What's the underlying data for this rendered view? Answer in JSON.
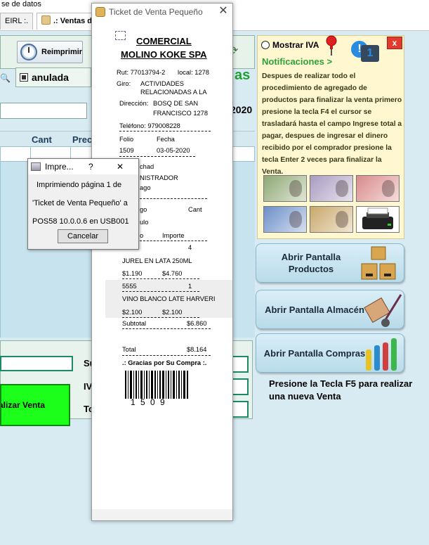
{
  "window": {
    "title_fragment": "se de datos"
  },
  "tabs": [
    {
      "label": "EIRL :."
    },
    {
      "label": ".: Ventas d"
    }
  ],
  "main": {
    "reimprimir_label": "Reimprimir",
    "anulada_label": "anulada",
    "right_fragment": "as",
    "year_fragment": "2020",
    "grid_headers": [
      "Cant",
      "Prec"
    ],
    "realizar_venta_label": "alizar Venta",
    "summary_labels": [
      "Su",
      "IV",
      "To"
    ]
  },
  "notification": {
    "mostrar_iva_label": "Mostrar IVA",
    "badge_count": "1",
    "close_symbol": "x",
    "title": "Notificaciones >",
    "body": "Despues de realizar todo el procedimiento de agregado de productos para finalizar la venta primero presione la tecla F4 el cursor se trasladará hasta el campo Ingrese total a pagar, despues de ingresar el dinero recibido por el comprador presione la tecla Enter 2 veces para finalizar la Venta.",
    "bill_colors": [
      "#8ea874",
      "#a99cc1",
      "#d98a8a",
      "#6d8fc9",
      "#c9a86b"
    ]
  },
  "side_buttons": [
    {
      "label": "Abrir Pantalla Productos",
      "icon": "boxes-icon"
    },
    {
      "label": "Abrir Pantalla Almacén",
      "icon": "hand-truck-icon"
    },
    {
      "label": "Abrir Pantalla Compras",
      "icon": "bar-chart-icon"
    }
  ],
  "f5_note": "Presione la Tecla F5 para realizar una nueva Venta",
  "ticket": {
    "window_title": "Ticket de Venta Pequeño",
    "company_line1": "COMERCIAL",
    "company_line2": "MOLINO KOKE SPA",
    "rut": "Rut:  77013794-2",
    "local": "local: 1278",
    "giro_label": "Giro:",
    "giro_value_1": "ACTIVIDADES",
    "giro_value_2": "RELACIONADAS A LA",
    "direccion_label": "Dirección:",
    "direccion_value_1": "BOSQ DE SAN",
    "direccion_value_2": "FRANCISCO 1278",
    "telefono": "Teléfono: 979008228",
    "folio_label": "Folio",
    "fecha_label": "Fecha",
    "folio_value": "1509",
    "fecha_value": "03-05-2020",
    "partial_1": "chad",
    "partial_2": "NISTRADOR",
    "partial_3": "ago",
    "cod_frag": "go",
    "cant_label": "Cant",
    "art_frag": "ulo",
    "precio_frag": "o",
    "importe_label": "Importe",
    "item1_qty": "4",
    "item1_name": "JUREL EN LATA 250ML",
    "item1_price": "$1.190",
    "item1_total": "$4.760",
    "item2_code": "5555",
    "item2_qty": "1",
    "item2_name": "VINO BLANCO LATE HARVERI",
    "item2_price": "$2.100",
    "item2_total": "$2.100",
    "subtotal_label": "Subtotal",
    "subtotal_value": "$6.860",
    "total_label": "Total",
    "total_value": "$8.164",
    "thanks": ".: Gracias por Su Compra :.",
    "barcode_digits": "1 5 0 9"
  },
  "print_dialog": {
    "title": "Impre...",
    "help_symbol": "?",
    "close_symbol": "✕",
    "line1": "Imprimiendo página 1 de",
    "line2": "'Ticket de Venta Pequeño' a",
    "line3": "POS58 10.0.0.6 en USB001",
    "cancel_label": "Cancelar"
  }
}
